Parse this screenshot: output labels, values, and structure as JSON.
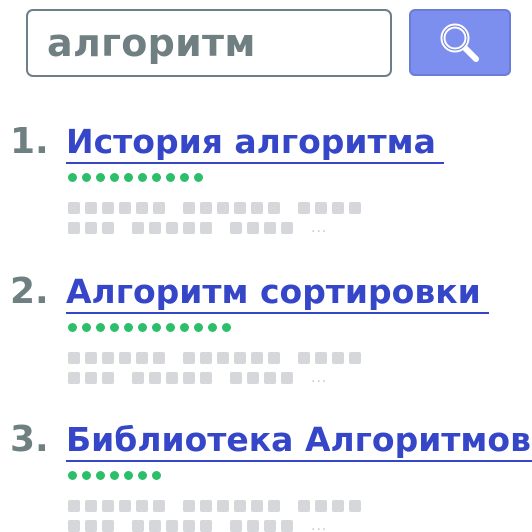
{
  "search": {
    "query": "алгоритм",
    "button_icon": "search-icon"
  },
  "results": [
    {
      "number": "1.",
      "title": "История алгоритма",
      "rating_dots": 10
    },
    {
      "number": "2.",
      "title": "Алгоритм сортировки",
      "rating_dots": 12
    },
    {
      "number": "3.",
      "title": "Библиотека Алгоритмов",
      "rating_dots": 7
    }
  ],
  "colors": {
    "link": "#3646c8",
    "button": "#7d8fee",
    "rating": "#2bbf69",
    "number": "#6f8083",
    "placeholder_text": "#d5d7da"
  }
}
